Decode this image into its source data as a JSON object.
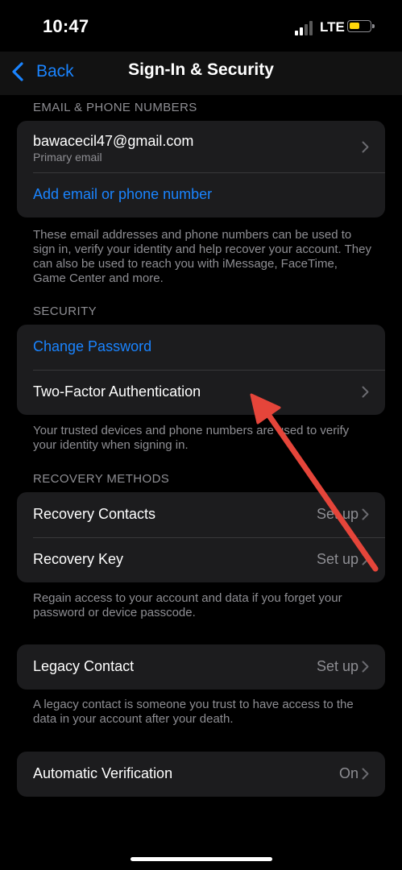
{
  "status_bar": {
    "time": "10:47",
    "network": "LTE",
    "battery_color": "#ffd60a"
  },
  "nav": {
    "back_label": "Back",
    "title": "Sign-In & Security"
  },
  "email_section": {
    "header": "EMAIL & PHONE NUMBERS",
    "email": "bawacecil47@gmail.com",
    "email_sub": "Primary email",
    "add_label": "Add email or phone number",
    "footer": "These email addresses and phone numbers can be used to sign in, verify your identity and help recover your account. They can also be used to reach you with iMessage, FaceTime, Game Center and more."
  },
  "security_section": {
    "header": "SECURITY",
    "change_password": "Change Password",
    "two_factor": "Two-Factor Authentication",
    "footer": "Your trusted devices and phone numbers are used to verify your identity when signing in."
  },
  "recovery_section": {
    "header": "RECOVERY METHODS",
    "contacts_label": "Recovery Contacts",
    "contacts_value": "Set up",
    "key_label": "Recovery Key",
    "key_value": "Set up",
    "footer": "Regain access to your account and data if you forget your password or device passcode."
  },
  "legacy_section": {
    "label": "Legacy Contact",
    "value": "Set up",
    "footer": "A legacy contact is someone you trust to have access to the data in your account after your death."
  },
  "verification_section": {
    "label": "Automatic Verification",
    "value": "On"
  },
  "colors": {
    "accent": "#1a84ff",
    "annotation_arrow": "#e5453a",
    "cell_bg": "#1c1c1e"
  }
}
